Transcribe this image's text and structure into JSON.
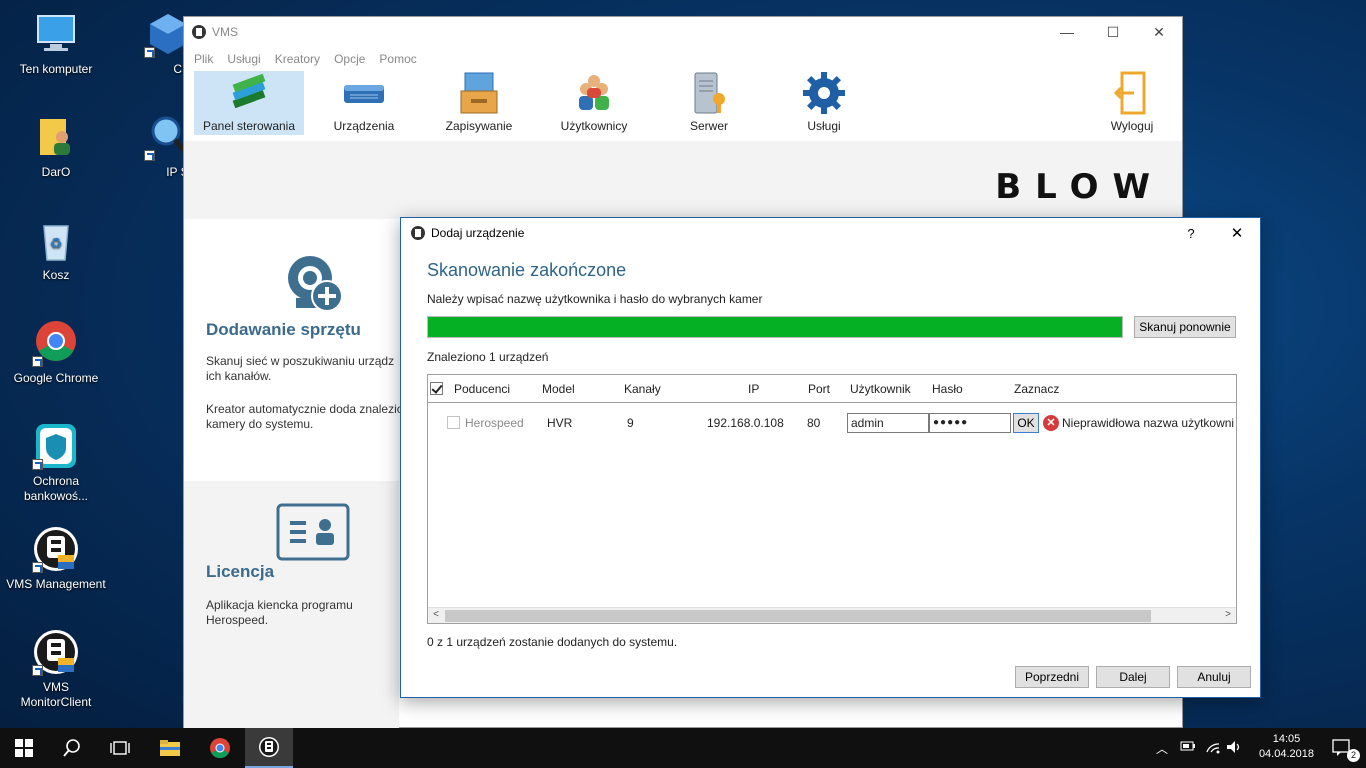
{
  "desktop": {
    "icons": [
      {
        "label": "Ten komputer"
      },
      {
        "label": "CMS"
      },
      {
        "label": "DarO"
      },
      {
        "label": "IP Searc"
      },
      {
        "label": "Kosz"
      },
      {
        "label": "Google Chrome"
      },
      {
        "label": "Ochrona bankowoś..."
      },
      {
        "label": "VMS Management"
      },
      {
        "label": "VMS MonitorClient"
      }
    ]
  },
  "vms": {
    "title": "VMS",
    "menu": [
      "Plik",
      "Usługi",
      "Kreatory",
      "Opcje",
      "Pomoc"
    ],
    "toolbar": [
      {
        "label": "Panel sterowania",
        "icon": "books-icon"
      },
      {
        "label": "Urządzenia",
        "icon": "dvr-device-icon"
      },
      {
        "label": "Zapisywanie",
        "icon": "storage-drawer-icon"
      },
      {
        "label": "Użytkownicy",
        "icon": "users-icon"
      },
      {
        "label": "Serwer",
        "icon": "server-key-icon"
      },
      {
        "label": "Usługi",
        "icon": "gear-icon"
      }
    ],
    "logout_label": "Wyloguj",
    "brand": "BLOW",
    "panels": {
      "add_hardware": {
        "title": "Dodawanie sprzętu",
        "text1": "Skanuj sieć w poszukiwaniu urządz ich kanałów.",
        "text2": "Kreator automatycznie doda znalezio kamery do systemu."
      },
      "license": {
        "title": "Licencja",
        "text": "Aplikacja kiencka programu Herospeed."
      }
    }
  },
  "dialog": {
    "title": "Dodaj urządzenie",
    "help": "?",
    "heading": "Skanowanie zakończone",
    "subtitle": "Należy wpisać nazwę użytkownika i hasło do wybranych kamer",
    "progress": 1.0,
    "rescan_label": "Skanuj ponownie",
    "found_text": "Znaleziono 1 urządzeń",
    "columns": [
      "Poducenci",
      "Model",
      "Kanały",
      "IP",
      "Port",
      "Użytkownik",
      "Hasło",
      "Zaznacz"
    ],
    "rows": [
      {
        "manufacturer": "Herospeed",
        "model": "HVR",
        "channels": "9",
        "ip": "192.168.0.108",
        "port": "80",
        "user": "admin",
        "password": "●●●●●",
        "ok_label": "OK",
        "error": "Nieprawidłowa nazwa użytkowni"
      }
    ],
    "summary": "0 z 1 urządzeń zostanie dodanych do systemu.",
    "buttons": {
      "prev": "Poprzedni",
      "next": "Dalej",
      "cancel": "Anuluj"
    }
  },
  "taskbar": {
    "time": "14:05",
    "date": "04.04.2018",
    "notifications": "2"
  }
}
